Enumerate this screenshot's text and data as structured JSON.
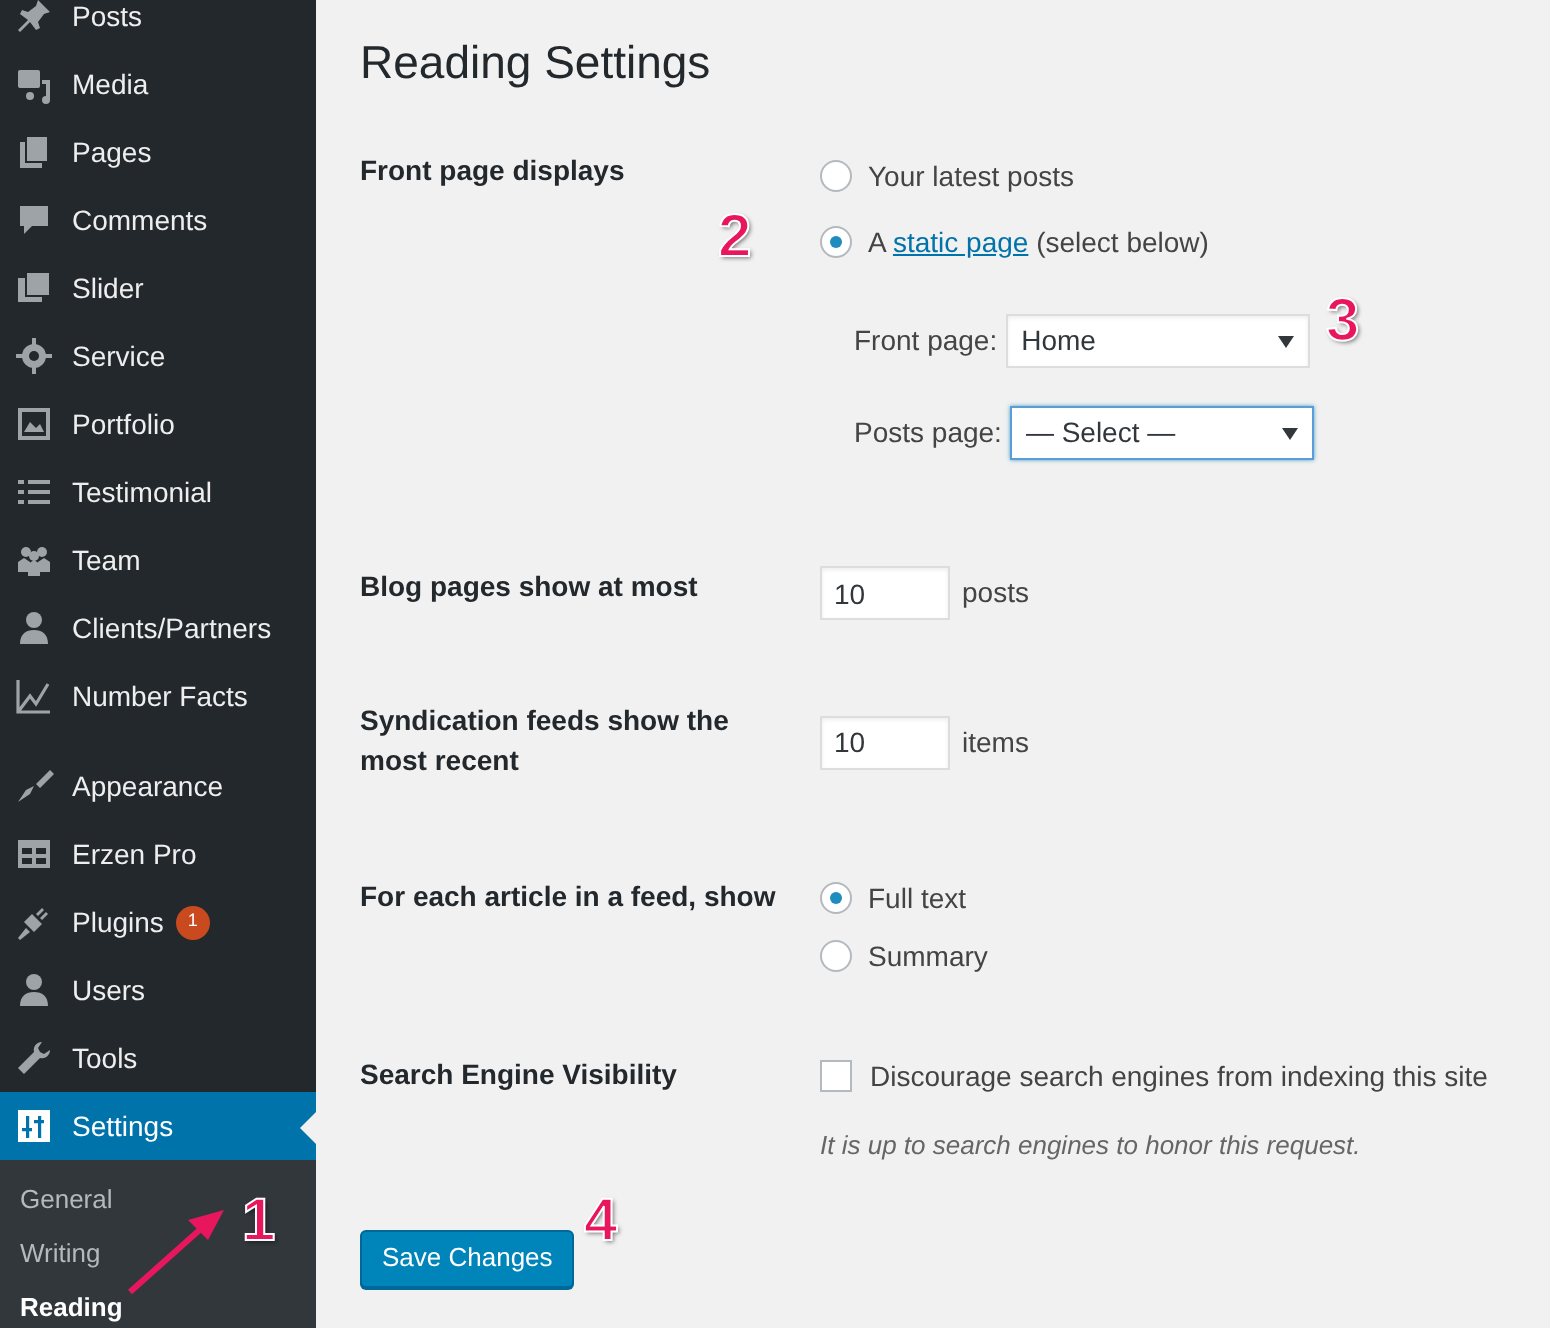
{
  "sidebar": {
    "groups": [
      [
        {
          "label": "Posts",
          "selected": false
        },
        {
          "label": "Media",
          "selected": false
        },
        {
          "label": "Pages",
          "selected": false
        },
        {
          "label": "Comments",
          "selected": false
        },
        {
          "label": "Slider",
          "selected": false
        },
        {
          "label": "Service",
          "selected": false
        },
        {
          "label": "Portfolio",
          "selected": false
        },
        {
          "label": "Testimonial",
          "selected": false
        },
        {
          "label": "Team",
          "selected": false
        },
        {
          "label": "Clients/Partners",
          "selected": false
        },
        {
          "label": "Number Facts",
          "selected": false
        }
      ],
      [
        {
          "label": "Appearance",
          "selected": false
        },
        {
          "label": "Erzen Pro",
          "selected": false
        },
        {
          "label": "Plugins",
          "selected": false,
          "badge": "1"
        },
        {
          "label": "Users",
          "selected": false
        },
        {
          "label": "Tools",
          "selected": false
        },
        {
          "label": "Settings",
          "selected": true,
          "submenu": [
            {
              "label": "General",
              "selected": false
            },
            {
              "label": "Writing",
              "selected": false
            },
            {
              "label": "Reading",
              "selected": true
            }
          ]
        }
      ]
    ]
  },
  "title": "Reading Settings",
  "front_page": {
    "label": "Front page displays",
    "options": [
      {
        "label": "Your latest posts",
        "selected": false
      },
      {
        "prefix": "A",
        "link": "static page",
        "suffix": "(select below)",
        "selected": true
      }
    ],
    "selects": [
      {
        "label": "Front page:",
        "value": "Home",
        "focused": false
      },
      {
        "label": "Posts page:",
        "value": "— Select —",
        "focused": true
      }
    ]
  },
  "blog_pages": {
    "label": "Blog pages show at most",
    "value": "10",
    "unit": "posts"
  },
  "syndication": {
    "label": "Syndication feeds show the most recent",
    "value": "10",
    "unit": "items"
  },
  "feed_article": {
    "label": "For each article in a feed, show",
    "options": [
      {
        "label": "Full text",
        "selected": true
      },
      {
        "label": "Summary",
        "selected": false
      }
    ]
  },
  "visibility": {
    "label": "Search Engine Visibility",
    "checkbox": "Discourage search engines from indexing this site",
    "checked": false,
    "hint": "It is up to search engines to honor this request."
  },
  "save_button": "Save Changes",
  "annotations": [
    {
      "text": "1"
    },
    {
      "text": "2"
    },
    {
      "text": "3"
    },
    {
      "text": "4"
    }
  ]
}
